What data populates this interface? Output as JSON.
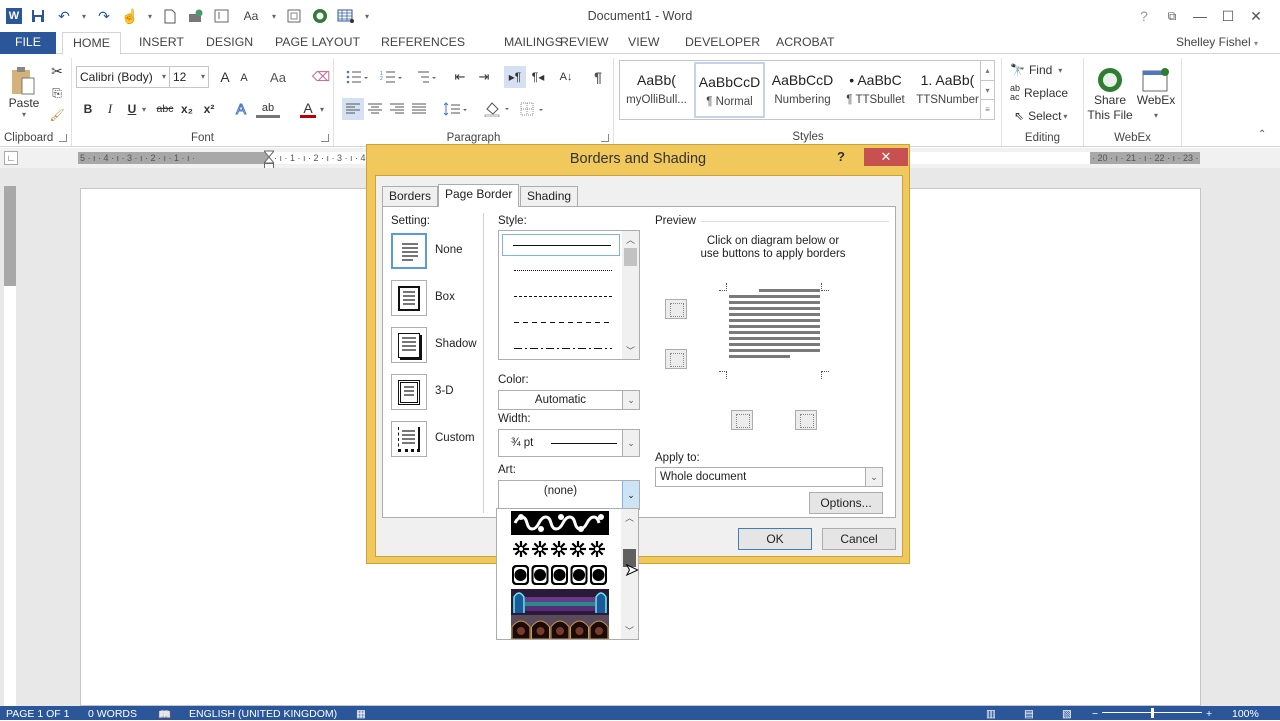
{
  "window": {
    "title": "Document1 - Word",
    "controls": [
      "help-icon",
      "ribbon-display-icon",
      "minimize-icon",
      "maximize-icon",
      "close-icon"
    ],
    "help_glyph": "?",
    "minimize_glyph": "—",
    "maximize_glyph": "☐",
    "close_glyph": "✕",
    "ribbon_display_glyph": "⧉"
  },
  "quick_access": {
    "word_glyph": "W",
    "save_glyph": "💾",
    "undo_glyph": "↶",
    "redo_glyph": "↷",
    "touch_glyph": "☝",
    "new_glyph": "🗋",
    "more_glyph": "▾",
    "fontsize_label": "Aa"
  },
  "tabs": [
    "FILE",
    "HOME",
    "INSERT",
    "DESIGN",
    "PAGE LAYOUT",
    "REFERENCES",
    "MAILINGS",
    "REVIEW",
    "VIEW",
    "DEVELOPER",
    "ACROBAT"
  ],
  "active_tab": "HOME",
  "user": "Shelley Fishel",
  "ribbon": {
    "clipboard": {
      "label": "Clipboard",
      "paste": "Paste"
    },
    "font": {
      "label": "Font",
      "font_name": "Calibri (Body)",
      "font_size": "12",
      "grow": "A",
      "shrink": "A",
      "change_case": "Aa",
      "bold": "B",
      "italic": "I",
      "underline": "U",
      "strike": "abc",
      "sub": "x₂",
      "sup": "x²",
      "text_effects": "A",
      "highlight": "ab",
      "font_color": "A",
      "font_color_hex": "#c00000"
    },
    "paragraph": {
      "label": "Paragraph",
      "show_marks": "¶",
      "sort": "A↓"
    },
    "styles": {
      "label": "Styles",
      "items": [
        {
          "preview": "AaBb(",
          "name": "myOlliBull...",
          "selected": false
        },
        {
          "preview": "AaBbCcD",
          "name": "¶ Normal",
          "selected": true
        },
        {
          "preview": "AaBbCcD",
          "name": "Numbering",
          "selected": false
        },
        {
          "preview": "• AaBbC",
          "name": "¶ TTSbullet",
          "selected": false
        },
        {
          "preview": "1. AaBb(",
          "name": "TTSNumber",
          "selected": false
        }
      ]
    },
    "editing": {
      "label": "Editing",
      "find": "Find",
      "replace": "Replace",
      "select": "Select"
    },
    "webex": {
      "label": "WebEx",
      "share1": "Share",
      "share2": "This File",
      "webex": "WebEx"
    }
  },
  "ruler": {
    "left_marks": "5 · ı · 4 · ı · 3 · ı · 2 · ı · 1 · ı · ",
    "right_marks": "· ı · 1 · ı · 2 · ı · 3 · ı · 4 · ı · 5 · ı · 6 · ı · 7 · ı · 8 · ı · 9 · ı · 10 · ı · 11 · ı · 12 · ı · 13 · ı · 14 · ı · 15 · ı · 16 · ı · 17 · ı · 18 · ı · 19 · ı ",
    "end_marks": "· 20 · ı · 21 · ı · 22 · ı · 23 · ı · 24 · ı"
  },
  "status": {
    "page": "PAGE 1 OF 1",
    "words": "0 WORDS",
    "language": "ENGLISH (UNITED KINGDOM)",
    "zoom": "100%",
    "zoom_percent": 100
  },
  "dialog": {
    "title": "Borders and Shading",
    "help": "?",
    "close": "✕",
    "tabs": [
      "Borders",
      "Page Border",
      "Shading"
    ],
    "active_tab": "Page Border",
    "setting_label": "Setting:",
    "settings": [
      "None",
      "Box",
      "Shadow",
      "3-D",
      "Custom"
    ],
    "selected_setting": "None",
    "style_label": "Style:",
    "styles": [
      "solid",
      "dotted",
      "dashed-small",
      "dashed",
      "dash-dot"
    ],
    "color_label": "Color:",
    "color_value": "Automatic",
    "width_label": "Width:",
    "width_value": "¾ pt",
    "art_label": "Art:",
    "art_value": "(none)",
    "art_options": [
      "vine-swirl",
      "asterisk-stars",
      "faces-blocks",
      "gothic-arches",
      "gilded-arches"
    ],
    "preview_label": "Preview",
    "preview_hint1": "Click on diagram below or",
    "preview_hint2": "use buttons to apply borders",
    "apply_to_label": "Apply to:",
    "apply_to_value": "Whole document",
    "options_btn": "Options...",
    "ok_btn": "OK",
    "cancel_btn": "Cancel"
  }
}
